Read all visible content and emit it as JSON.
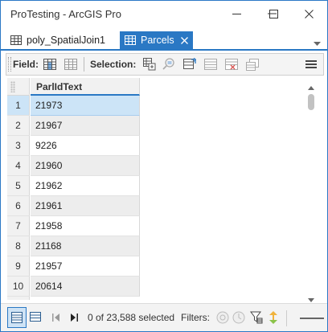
{
  "window": {
    "title": "ProTesting - ArcGIS Pro"
  },
  "tabs": [
    {
      "label": "poly_SpatialJoin1",
      "active": false,
      "icon": "table-icon"
    },
    {
      "label": "Parcels",
      "active": true,
      "icon": "table-icon"
    }
  ],
  "toolbar": {
    "field_label": "Field:",
    "selection_label": "Selection:",
    "icons": [
      "add-field-icon",
      "calculate-field-icon",
      "select-by-attributes-icon",
      "zoom-to-selection-icon",
      "switch-selection-icon",
      "clear-selection-icon",
      "delete-selection-icon",
      "copy-selection-icon",
      "menu-icon"
    ]
  },
  "table": {
    "column_header": "ParlIdText",
    "rows": [
      {
        "num": "1",
        "value": "21973"
      },
      {
        "num": "2",
        "value": "21967"
      },
      {
        "num": "3",
        "value": "9226"
      },
      {
        "num": "4",
        "value": "21960"
      },
      {
        "num": "5",
        "value": "21962"
      },
      {
        "num": "6",
        "value": "21961"
      },
      {
        "num": "7",
        "value": "21958"
      },
      {
        "num": "8",
        "value": "21168"
      },
      {
        "num": "9",
        "value": "21957"
      },
      {
        "num": "10",
        "value": "20614"
      }
    ],
    "selected_row": "1"
  },
  "status": {
    "selection_text": "0 of 23,588 selected",
    "filters_label": "Filters:"
  },
  "colors": {
    "accent": "#2a78c4",
    "selected_row": "#cce4f7",
    "alt_row": "#ededed"
  }
}
